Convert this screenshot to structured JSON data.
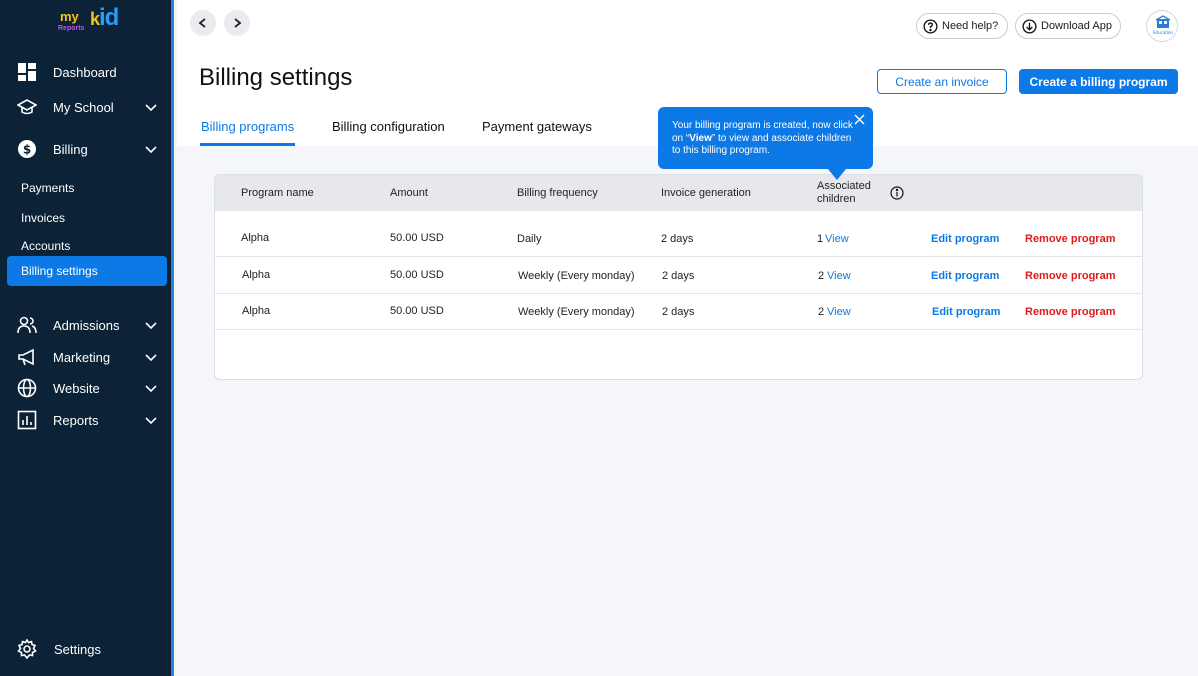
{
  "logo": {
    "my": "my",
    "reports": "Reports",
    "kid_k": "k",
    "kid_rest": "id"
  },
  "sidebar": {
    "dashboard": "Dashboard",
    "my_school": "My School",
    "billing": "Billing",
    "billing_sub": [
      "Payments",
      "Invoices",
      "Accounts",
      "Billing settings"
    ],
    "admissions": "Admissions",
    "marketing": "Marketing",
    "website": "Website",
    "reports": "Reports",
    "settings": "Settings"
  },
  "header": {
    "need_help": "Need help?",
    "download_app": "Download App",
    "avatar_label": "Education",
    "title": "Billing settings",
    "create_invoice": "Create an invoice",
    "create_program": "Create a billing program"
  },
  "tabs": [
    "Billing programs",
    "Billing configuration",
    "Payment gateways"
  ],
  "tooltip": {
    "text_before": "Your billing program is created, now click on “",
    "text_bold": "View",
    "text_after": "” to view and associate children to this billing program."
  },
  "table": {
    "headers": [
      "Program name",
      "Amount",
      "Billing frequency",
      "Invoice generation",
      "Associated",
      "children"
    ],
    "rows": [
      {
        "name": "Alpha",
        "amount": "50.00 USD",
        "frequency": "Daily",
        "generation": "2 days",
        "children_count": "1",
        "view": "View",
        "edit": "Edit program",
        "remove": "Remove program"
      },
      {
        "name": "Alpha",
        "amount": "50.00 USD",
        "frequency": "Weekly (Every monday)",
        "generation": "2 days",
        "children_count": "2",
        "view": "View",
        "edit": "Edit program",
        "remove": "Remove program"
      },
      {
        "name": "Alpha",
        "amount": "50.00 USD",
        "frequency": "Weekly (Every monday)",
        "generation": "2 days",
        "children_count": "2",
        "view": "View",
        "edit": "Edit program",
        "remove": "Remove program"
      }
    ]
  },
  "colors": {
    "sidebar_bg": "#0b2237",
    "accent": "#0c79e6",
    "danger": "#e01b1b"
  },
  "icons": [
    "dashboard-icon",
    "school-icon",
    "dollar-icon",
    "people-icon",
    "megaphone-icon",
    "globe-icon",
    "chart-icon",
    "gear-icon",
    "help-icon",
    "download-icon",
    "info-icon",
    "close-icon"
  ]
}
